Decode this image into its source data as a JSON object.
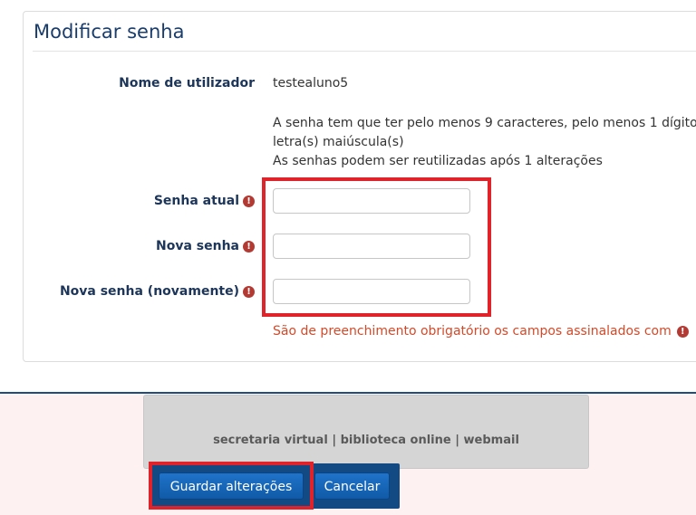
{
  "form": {
    "title": "Modificar senha",
    "username_label": "Nome de utilizador",
    "username_value": "testealuno5",
    "policy_lines": [
      "A senha tem que ter pelo menos 9 caracteres, pelo menos 1 dígito",
      "letra(s) maiúscula(s)",
      "As senhas podem ser reutilizadas após 1 alterações"
    ],
    "current_password_label": "Senha atual",
    "new_password_label": "Nova senha",
    "new_password_again_label": "Nova senha (novamente)",
    "required_icon": "!",
    "required_note": "São de preenchimento obrigatório os campos assinalados com",
    "required_icon_name": "required-exclamation-icon",
    "required_color": "#b23a33"
  },
  "footer": {
    "links": [
      "secretaria virtual",
      "biblioteca online",
      "webmail"
    ],
    "separator": "|"
  },
  "actions": {
    "save_label": "Guardar alterações",
    "cancel_label": "Cancelar"
  },
  "highlight_color": "#e0232b"
}
